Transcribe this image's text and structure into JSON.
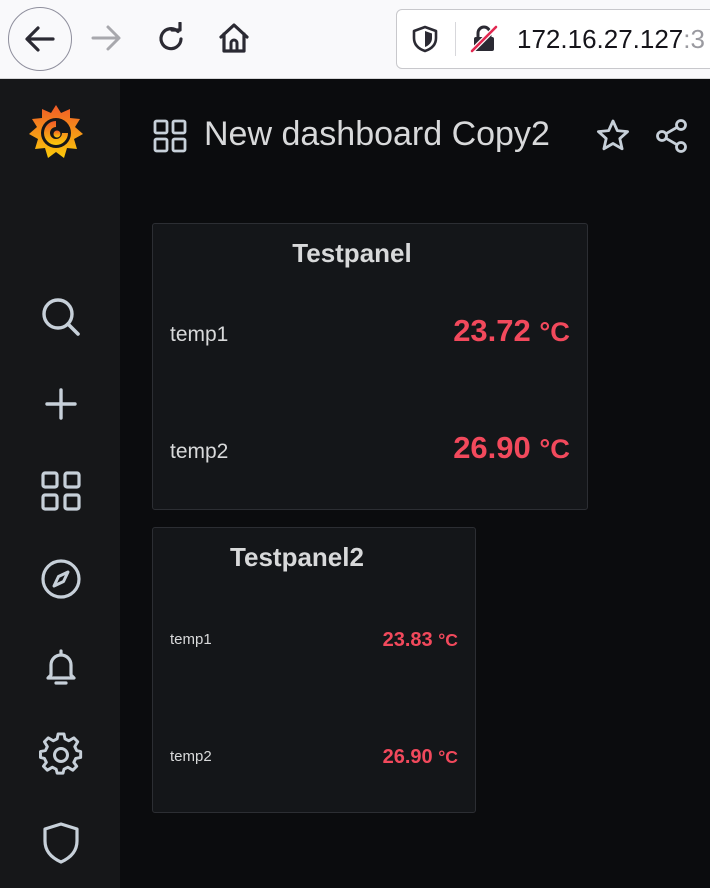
{
  "browser": {
    "url_host": "172.16.27.127",
    "url_port_fragment": ":3",
    "icons": {
      "back": "arrow-left-icon",
      "forward": "arrow-right-icon",
      "reload": "reload-icon",
      "home": "home-icon",
      "tracking": "shield-icon",
      "insecure": "insecure-lock-icon"
    }
  },
  "sidebar": {
    "logo": "grafana-logo",
    "items": [
      {
        "name": "search",
        "icon": "search-icon"
      },
      {
        "name": "create",
        "icon": "plus-icon"
      },
      {
        "name": "dashboards",
        "icon": "apps-icon"
      },
      {
        "name": "explore",
        "icon": "compass-icon"
      },
      {
        "name": "alerting",
        "icon": "bell-icon"
      },
      {
        "name": "configuration",
        "icon": "gear-icon"
      },
      {
        "name": "server-admin",
        "icon": "shield-icon"
      }
    ]
  },
  "header": {
    "title": "New dashboard Copy2",
    "icons": [
      "grid-icon",
      "star-icon",
      "share-icon"
    ]
  },
  "panels": [
    {
      "title": "Testpanel",
      "stats": [
        {
          "label": "temp1",
          "value": "23.72",
          "unit": "°C"
        },
        {
          "label": "temp2",
          "value": "26.90",
          "unit": "°C"
        }
      ]
    },
    {
      "title": "Testpanel2",
      "stats": [
        {
          "label": "temp1",
          "value": "23.83",
          "unit": "°C"
        },
        {
          "label": "temp2",
          "value": "26.90",
          "unit": "°C"
        }
      ]
    }
  ],
  "colors": {
    "background": "#0b0c0e",
    "sidebar": "#161719",
    "panel": "#141619",
    "text": "#d8d9da",
    "value_red": "#f2495c",
    "logo_orange": "#f46800",
    "logo_yellow": "#fbca0a"
  }
}
